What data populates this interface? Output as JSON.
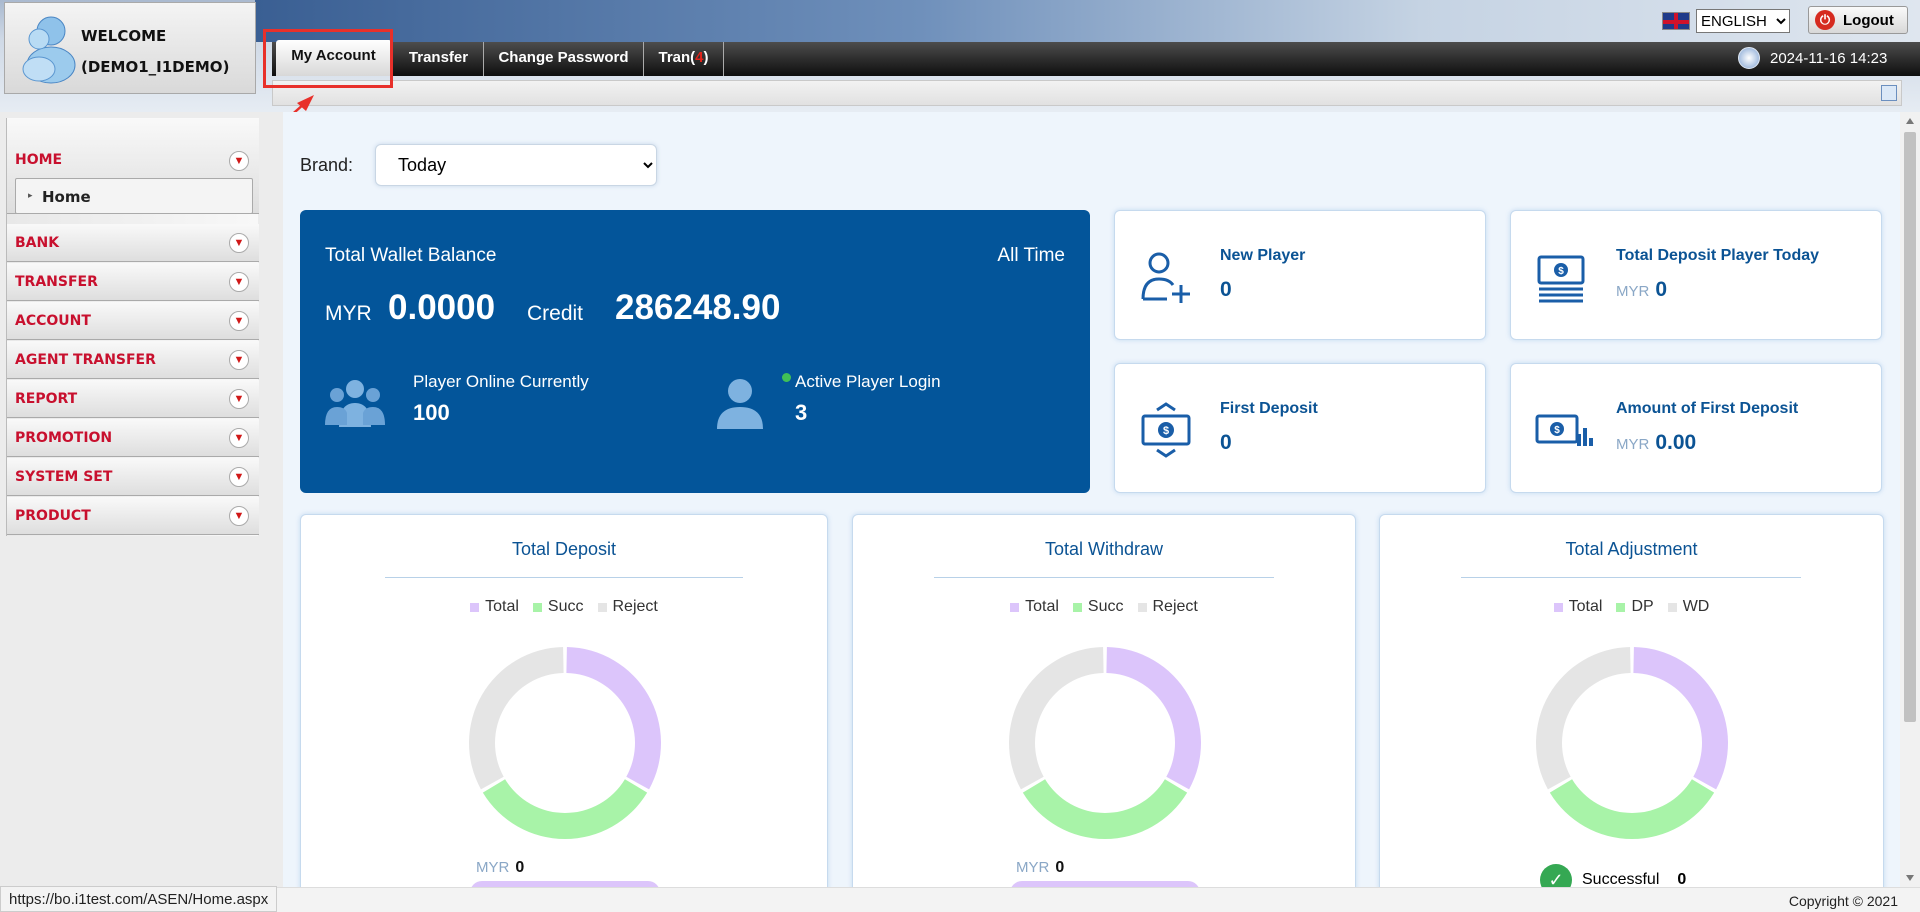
{
  "header": {
    "welcome_line1": "WELCOME",
    "welcome_line2": "(DEMO1_I1DEMO)",
    "language": "ENGLISH",
    "logout_label": "Logout",
    "datetime": "2024-11-16 14:23"
  },
  "tabs": [
    {
      "label": "My Account",
      "active": true
    },
    {
      "label": "Transfer"
    },
    {
      "label": "Change Password"
    },
    {
      "label_prefix": "Tran",
      "label_open": "(",
      "label_count": "4",
      "label_close": ")"
    }
  ],
  "sidebar": {
    "items": [
      {
        "label": "HOME"
      },
      {
        "label": "BANK"
      },
      {
        "label": "TRANSFER"
      },
      {
        "label": "ACCOUNT"
      },
      {
        "label": "AGENT TRANSFER"
      },
      {
        "label": "REPORT"
      },
      {
        "label": "PROMOTION"
      },
      {
        "label": "SYSTEM SET"
      },
      {
        "label": "PRODUCT"
      }
    ],
    "submenu": {
      "label": "Home"
    }
  },
  "brand": {
    "label": "Brand:",
    "selected": "Today"
  },
  "wallet": {
    "title": "Total Wallet Balance",
    "period": "All Time",
    "currency": "MYR",
    "balance": "0.0000",
    "credit_label": "Credit",
    "credit_value": "286248.90",
    "players_online_label": "Player Online Currently",
    "players_online_value": "100",
    "active_login_label": "Active Player Login",
    "active_login_value": "3"
  },
  "stats": [
    {
      "title": "New Player",
      "currency": "",
      "value": "0",
      "icon": "user-plus-icon"
    },
    {
      "title": "Total Deposit Player Today",
      "currency": "MYR",
      "value": "0",
      "icon": "money-stack-icon"
    },
    {
      "title": "First Deposit",
      "currency": "",
      "value": "0",
      "icon": "money-cycle-icon"
    },
    {
      "title": "Amount of First Deposit",
      "currency": "MYR",
      "value": "0.00",
      "icon": "money-chart-icon"
    }
  ],
  "colors": {
    "total": "#dcc5fb",
    "success": "#a8f3a8",
    "reject": "#e5e5e5",
    "wallet_bg": "#03559a",
    "accent": "#0b5394"
  },
  "charts": [
    {
      "title": "Total Deposit",
      "legend": [
        "Total",
        "Succ",
        "Reject"
      ],
      "currency": "MYR",
      "value": "0"
    },
    {
      "title": "Total Withdraw",
      "legend": [
        "Total",
        "Succ",
        "Reject"
      ],
      "currency": "MYR",
      "value": "0"
    },
    {
      "title": "Total Adjustment",
      "legend": [
        "Total",
        "DP",
        "WD"
      ],
      "success_label": "Successful",
      "success_value": "0"
    }
  ],
  "chart_data": [
    {
      "type": "pie",
      "title": "Total Deposit",
      "categories": [
        "Total",
        "Succ",
        "Reject"
      ],
      "values": [
        1,
        1,
        1
      ]
    },
    {
      "type": "pie",
      "title": "Total Withdraw",
      "categories": [
        "Total",
        "Succ",
        "Reject"
      ],
      "values": [
        1,
        1,
        1
      ]
    },
    {
      "type": "pie",
      "title": "Total Adjustment",
      "categories": [
        "Total",
        "DP",
        "WD"
      ],
      "values": [
        1,
        1,
        1
      ]
    }
  ],
  "footer": {
    "status_url": "https://bo.i1test.com/ASEN/Home.aspx",
    "copyright": "Copyright © 2021"
  }
}
